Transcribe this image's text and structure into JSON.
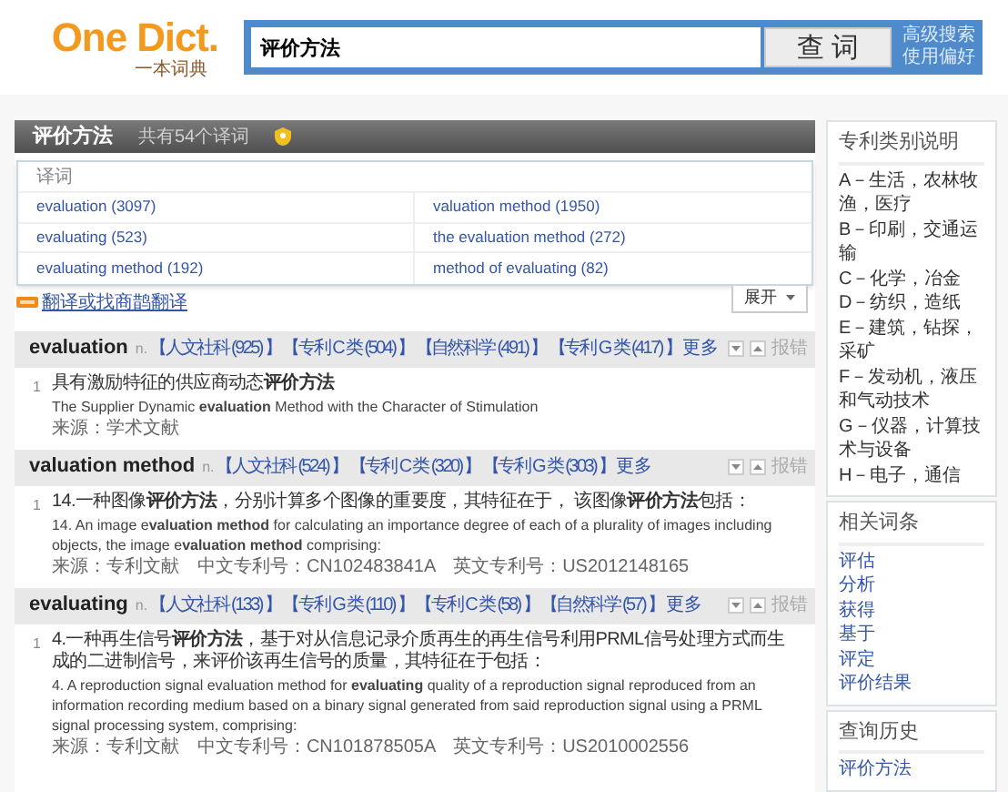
{
  "logo": {
    "title": "One Dict.",
    "subtitle": "一本词典"
  },
  "search": {
    "value": "评价方法",
    "button": "查 词",
    "links": [
      "高级搜索",
      "使用偏好"
    ]
  },
  "result_bar": {
    "term": "评价方法",
    "count": "共有54个译词"
  },
  "translations": {
    "header": "译词",
    "items": [
      "evaluation (3097)",
      "valuation method (1950)",
      "evaluating (523)",
      "the evaluation method (272)",
      "evaluating method (192)",
      "method of evaluating (82)"
    ],
    "expand": "展开"
  },
  "translate_link": "翻译或找商鹊翻译",
  "entries": [
    {
      "headword": "evaluation",
      "pos": "n.",
      "categories": [
        "【人文社科 (925) 】",
        "【专利 C 类 (504) 】",
        "【自然科学 (491) 】",
        "【专利 G 类 (417) 】"
      ],
      "more": "更多",
      "report": "报错",
      "examples": [
        {
          "number": "1",
          "zh": "具有激励特征的供应商动态**评价方法**",
          "en": "The Supplier Dynamic **evaluation** Method with the Character of Stimulation",
          "source": "来源：学术文献"
        }
      ]
    },
    {
      "headword": "valuation method",
      "pos": "n.",
      "categories": [
        "【人文社科 (524) 】",
        "【专利 C 类 (320) 】",
        "【专利 G 类 (303) 】"
      ],
      "more": "更多",
      "report": "报错",
      "examples": [
        {
          "number": "1",
          "zh": "14.一种图像**评价方法**，分别计算多个图像的重要度，其特征在于， 该图像**评价方法**包括：",
          "en": "14. An image e**valuation method** for calculating an importance degree of each of a plurality of images including objects, the image e**valuation method** comprising:",
          "source": "来源：专利文献　中文专利号：CN102483841A　英文专利号：US2012148165"
        }
      ]
    },
    {
      "headword": "evaluating",
      "pos": "n.",
      "categories": [
        "【人文社科 (133) 】",
        "【专利 G 类 (110) 】",
        "【专利 C 类 (58) 】",
        "【自然科学 (57) 】"
      ],
      "more": "更多",
      "report": "报错",
      "examples": [
        {
          "number": "1",
          "zh": "4.一种再生信号**评价方法**，基于对从信息记录介质再生的再生信号利用PRML信号处理方式而生成的二进制信号，来评价该再生信号的质量，其特征在于包括：",
          "en": "4. A reproduction signal evaluation method for **evaluating** quality of a reproduction signal reproduced from an information recording medium based on a binary signal generated from said reproduction signal using a PRML signal processing system, comprising:",
          "source": "来源：专利文献　中文专利号：CN101878505A　英文专利号：US2010002556"
        }
      ]
    }
  ],
  "sidebar": [
    {
      "kind": "legend",
      "title": "专利类别说明",
      "items": [
        "A－生活，农林牧渔，医疗",
        "B－印刷，交通运输",
        "C－化学，冶金",
        "D－纺织，造纸",
        "E－建筑，钻探，采矿",
        "F－发动机，液压和气动技术",
        "G－仪器，计算技术与设备",
        "H－电子，通信"
      ]
    },
    {
      "kind": "links",
      "title": "相关词条",
      "items": [
        "评估",
        "分析",
        "获得",
        "基于",
        "评定",
        "评价结果"
      ]
    },
    {
      "kind": "links",
      "title": "查询历史",
      "items": [
        "评价方法"
      ]
    }
  ]
}
